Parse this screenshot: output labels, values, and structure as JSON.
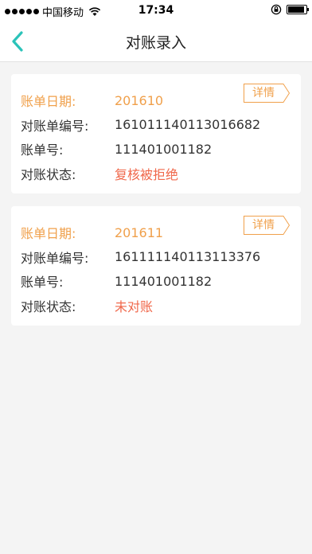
{
  "status_bar": {
    "carrier": "中国移动",
    "time": "17:34"
  },
  "nav": {
    "title": "对账录入",
    "back_icon": "chevron-left-icon"
  },
  "colors": {
    "accent": "#2bc3b9",
    "orange": "#f0a04b",
    "status_red": "#f0684b"
  },
  "records": [
    {
      "date_label": "账单日期:",
      "date": "201610",
      "detail_label": "详情",
      "number_label": "对账单编号:",
      "number": "161011140113016682",
      "account_label": "账单号:",
      "account": "111401001182",
      "status_label": "对账状态:",
      "status": "复核被拒绝"
    },
    {
      "date_label": "账单日期:",
      "date": "201611",
      "detail_label": "详情",
      "number_label": "对账单编号:",
      "number": "161111140113113376",
      "account_label": "账单号:",
      "account": "111401001182",
      "status_label": "对账状态:",
      "status": "未对账"
    }
  ]
}
